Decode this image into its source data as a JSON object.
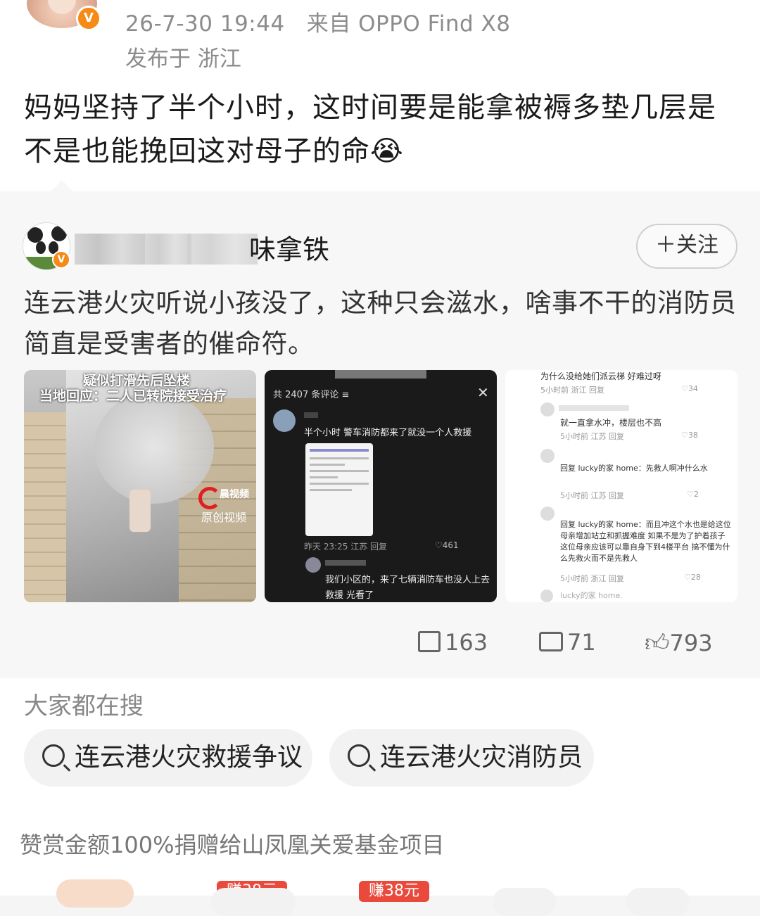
{
  "post": {
    "meta_time": "26-7-30 19:44",
    "meta_source": "来自 OPPO Find X8",
    "location": "发布于 浙江",
    "text": "妈妈坚持了半个小时，这时间要是能拿被褥多垫几层是不是也能挽回这对母子的命😭"
  },
  "repost": {
    "username": "味拿铁",
    "follow_label": "＋关注",
    "text": "连云港火灾听说小孩没了，这种只会滋水，啥事不干的消防员简直是受害者的催命符。",
    "images": [
      {
        "name": "news-video-still",
        "caption_top": "疑似打滑先后坠楼",
        "caption": "当地回应：二人已转院接受治疗",
        "logo": "晨视频",
        "logo_sub": "原创视频"
      },
      {
        "name": "comments-screenshot-dark",
        "header": "共 2407 条评论 ≡",
        "comment1": "半个小时 警车消防都来了就没一个人救援",
        "time1": "昨天 23:25 江苏  回复",
        "likes1": "♡461",
        "comment2": "我们小区的，来了七辆消防车也没人上去救援 光看了"
      },
      {
        "name": "comments-screenshot-light",
        "line1": "为什么没给她们派云梯 好难过呀",
        "meta1": "5小时前 浙江  回复",
        "likes1": "♡34",
        "line2": "就一直拿水冲，楼层也不高",
        "meta2": "5小时前 江苏  回复",
        "likes2": "♡38",
        "line3": "回复 lucky的家 home：先救人啊冲什么水",
        "meta3": "5小时前 江苏  回复",
        "likes3": "♡2",
        "line4": "回复 lucky的家 home：而且冲这个水也是给这位母亲增加站立和抓握难度 如果不是为了护着孩子 这位母亲应该可以靠自身下到4楼平台 搞不懂为什么先救火而不是先救人",
        "meta4": "5小时前 浙江  回复",
        "likes4": "♡28",
        "line5": "lucky的家 home."
      }
    ],
    "stats": {
      "reposts": "163",
      "comments": "71",
      "likes": "793"
    }
  },
  "search": {
    "title": "大家都在搜",
    "chips": [
      "连云港火灾救援争议",
      "连云港火灾消防员"
    ]
  },
  "donate_text": "赞赏金额100%捐赠给山凤凰关爱基金项目",
  "bottom_tags": [
    "赚38元",
    "赚38元"
  ]
}
